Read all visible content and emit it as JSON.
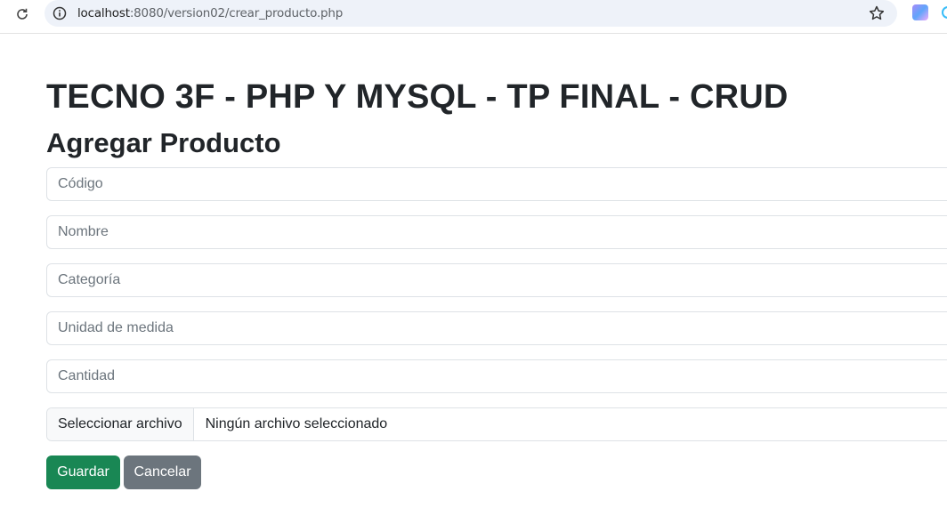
{
  "browser": {
    "url_host": "localhost",
    "url_path": ":8080/version02/crear_producto.php"
  },
  "page": {
    "title": "TECNO 3F - PHP Y MYSQL - TP FINAL - CRUD",
    "subtitle": "Agregar Producto"
  },
  "form": {
    "codigo": {
      "placeholder": "Código",
      "value": ""
    },
    "nombre": {
      "placeholder": "Nombre",
      "value": ""
    },
    "categoria": {
      "placeholder": "Categoría",
      "value": ""
    },
    "unidad": {
      "placeholder": "Unidad de medida",
      "value": ""
    },
    "cantidad": {
      "placeholder": "Cantidad",
      "value": ""
    },
    "file": {
      "button_label": "Seleccionar archivo",
      "status": "Ningún archivo seleccionado"
    },
    "save_label": "Guardar",
    "cancel_label": "Cancelar"
  },
  "colors": {
    "save": "#198754",
    "cancel": "#6c757d"
  }
}
